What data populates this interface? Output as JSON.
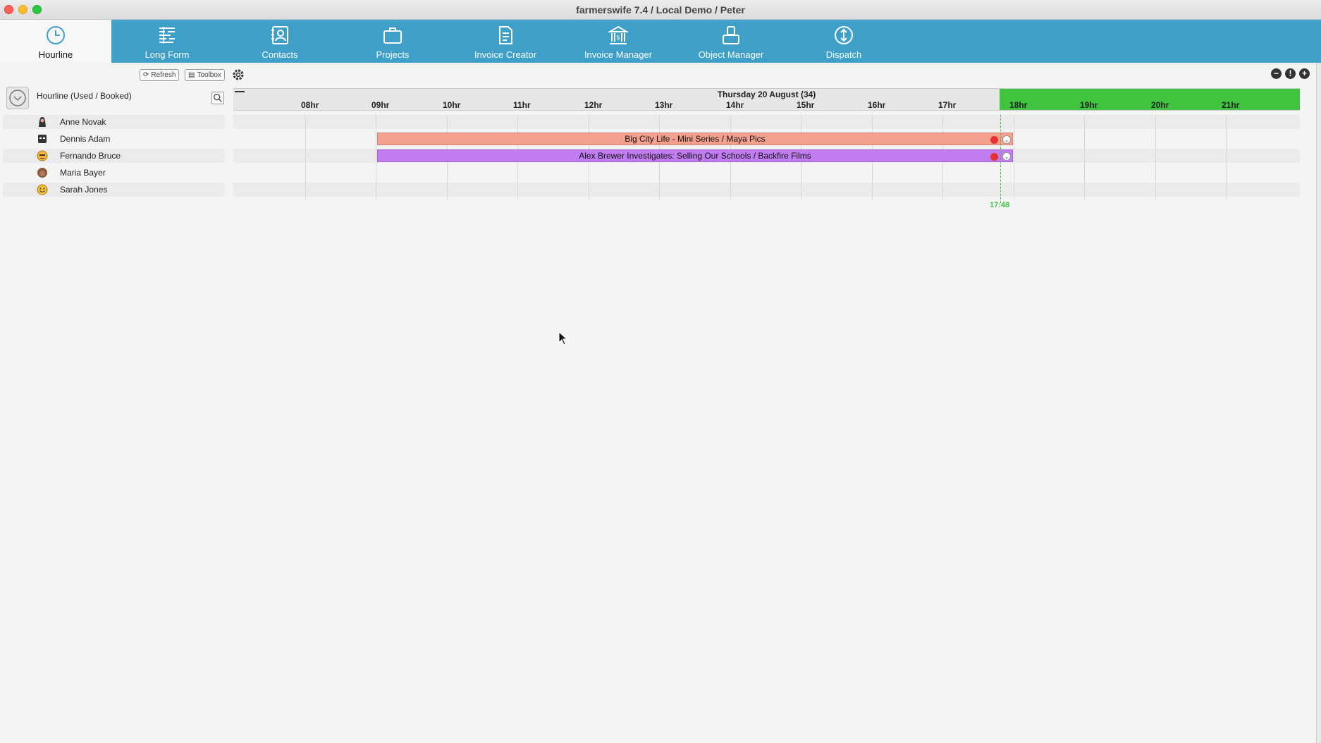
{
  "window": {
    "title": "farmerswife 7.4  / Local Demo / Peter"
  },
  "nav": {
    "items": [
      {
        "label": "Hourline",
        "icon": "clock-icon",
        "active": true
      },
      {
        "label": "Long Form",
        "icon": "long-form-icon",
        "active": false
      },
      {
        "label": "Contacts",
        "icon": "contacts-icon",
        "active": false
      },
      {
        "label": "Projects",
        "icon": "briefcase-icon",
        "active": false
      },
      {
        "label": "Invoice Creator",
        "icon": "document-icon",
        "active": false
      },
      {
        "label": "Invoice Manager",
        "icon": "bank-icon",
        "active": false
      },
      {
        "label": "Object Manager",
        "icon": "objects-icon",
        "active": false
      },
      {
        "label": "Dispatch",
        "icon": "dispatch-icon",
        "active": false
      }
    ]
  },
  "toolbar": {
    "refresh_label": "Refresh",
    "toolbox_label": "Toolbox"
  },
  "panel": {
    "title": "Hourline (Used / Booked)"
  },
  "resources": [
    {
      "name": "Anne Novak",
      "avatar": "person-icon"
    },
    {
      "name": "Dennis Adam",
      "avatar": "mask-icon"
    },
    {
      "name": "Fernando Bruce",
      "avatar": "smiley-icon"
    },
    {
      "name": "Maria Bayer",
      "avatar": "head-icon"
    },
    {
      "name": "Sarah Jones",
      "avatar": "happy-face-icon"
    }
  ],
  "timeline": {
    "day": "Thursday 20 August (34)",
    "hours": [
      "08hr",
      "09hr",
      "10hr",
      "11hr",
      "12hr",
      "13hr",
      "14hr",
      "15hr",
      "16hr",
      "17hr",
      "18hr",
      "19hr",
      "20hr",
      "21hr"
    ],
    "now": "17:48"
  },
  "bookings": [
    {
      "title": "Big City Life - Mini Series / Maya Pics",
      "resource": "Dennis Adam",
      "start": "09:00",
      "end": "18:10",
      "color": "#f4a08e"
    },
    {
      "title": "Alex Brewer Investigates: Selling Our Schools / Backfire Films",
      "resource": "Fernando Bruce",
      "start": "09:00",
      "end": "18:10",
      "color": "#c07cf0"
    }
  ],
  "colors": {
    "nav_bg": "#3e9fc8",
    "now_green": "#3ec43e"
  }
}
